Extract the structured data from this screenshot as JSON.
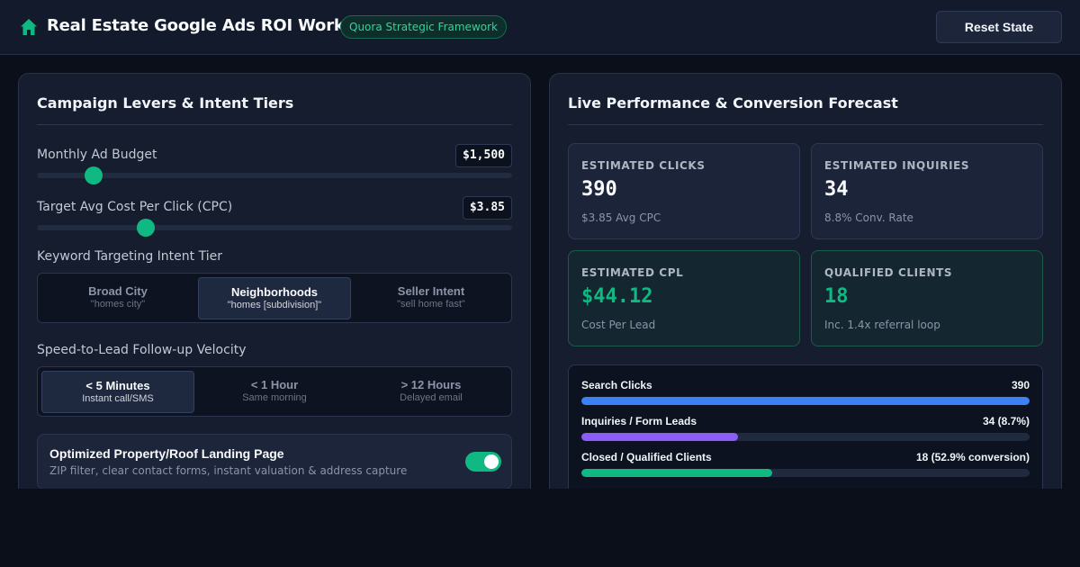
{
  "header": {
    "title": "Real Estate Google Ads ROI Workbench",
    "badge": "Quora Strategic Framework",
    "reset_label": "Reset State",
    "icon": "home-icon"
  },
  "levers": {
    "title": "Campaign Levers & Intent Tiers",
    "budget": {
      "label": "Monthly Ad Budget",
      "display": "$1,500",
      "level": 0.12
    },
    "cpc": {
      "label": "Target Avg Cost Per Click (CPC)",
      "display": "$3.85",
      "level": 0.23
    },
    "intent": {
      "label": "Keyword Targeting Intent Tier",
      "options": [
        {
          "title": "Broad City",
          "sub": "\"homes city\""
        },
        {
          "title": "Neighborhoods",
          "sub": "\"homes [subdivision]\""
        },
        {
          "title": "Seller Intent",
          "sub": "\"sell home fast\""
        }
      ],
      "selected": "Neighborhoods"
    },
    "speed": {
      "label": "Speed-to-Lead Follow-up Velocity",
      "options": [
        {
          "title": "< 5 Minutes",
          "sub": "Instant call/SMS"
        },
        {
          "title": "< 1 Hour",
          "sub": "Same morning"
        },
        {
          "title": "> 12 Hours",
          "sub": "Delayed email"
        }
      ],
      "selected": "< 5 Minutes"
    },
    "landing": {
      "title": "Optimized Property/Roof Landing Page",
      "sub": "ZIP filter, clear contact forms, instant valuation & address capture",
      "enabled": true
    }
  },
  "forecast": {
    "title": "Live Performance & Conversion Forecast",
    "metrics": [
      {
        "label": "ESTIMATED CLICKS",
        "value": "390",
        "sub": "$3.85 Avg CPC"
      },
      {
        "label": "ESTIMATED INQUIRIES",
        "value": "34",
        "sub": "8.8% Conv. Rate"
      },
      {
        "label": "ESTIMATED CPL",
        "value": "$44.12",
        "sub": "Cost Per Lead"
      },
      {
        "label": "QUALIFIED CLIENTS",
        "value": "18",
        "sub": "Inc. 1.4x referral loop"
      }
    ],
    "funnel": [
      {
        "label": "Search Clicks",
        "value": "390",
        "fraction": 1.0,
        "color": "#3b82f6"
      },
      {
        "label": "Inquiries / Form Leads",
        "value": "34 (8.7%)",
        "fraction": 0.35,
        "color": "#8b5cf6"
      },
      {
        "label": "Closed / Qualified Clients",
        "value": "18 (52.9% conversion)",
        "fraction": 0.425,
        "color": "#10b981"
      }
    ]
  },
  "colors": {
    "accent": "#10b981",
    "background": "#0b0f19",
    "panel": "#151d2e"
  }
}
